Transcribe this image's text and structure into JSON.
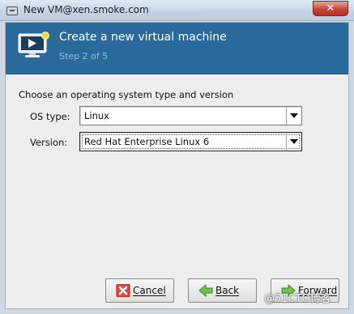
{
  "window": {
    "title": "New VM@xen.smoke.com",
    "close_label": "✕"
  },
  "banner": {
    "title": "Create a new virtual machine",
    "step": "Step 2 of 5"
  },
  "form": {
    "heading": "Choose an operating system type and version",
    "os_type_label": "OS type:",
    "os_type_value": "Linux",
    "version_label": "Version:",
    "version_value": "Red Hat Enterprise Linux 6"
  },
  "buttons": {
    "cancel": "Cancel",
    "back": "Back",
    "forward": "Forward"
  },
  "watermark": "@51CTO博客",
  "colors": {
    "banner": "#2a6a9a",
    "step_text": "#8fc0e2",
    "close": "#c9453b"
  }
}
